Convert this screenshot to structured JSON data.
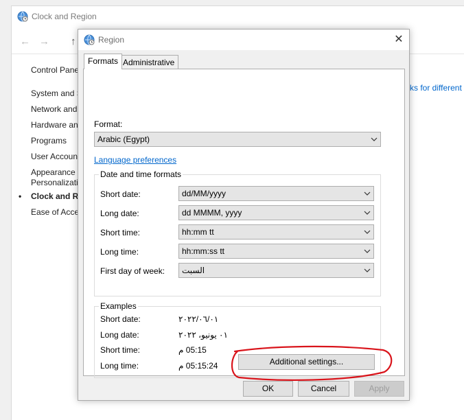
{
  "background_window": {
    "title": "Clock and Region",
    "sidebar": {
      "items": [
        {
          "label": "Control Pane"
        },
        {
          "label": "System and S"
        },
        {
          "label": "Network and"
        },
        {
          "label": "Hardware and"
        },
        {
          "label": "Programs"
        },
        {
          "label": "User Account"
        },
        {
          "label": "Appearance a"
        },
        {
          "label": "Personalizatio"
        },
        {
          "label": "Clock and Re"
        },
        {
          "label": "Ease of Acces"
        }
      ],
      "current_bullet": "•"
    },
    "link_fragment": "ks for different"
  },
  "dialog": {
    "title": "Region",
    "close_glyph": "✕",
    "tabs": [
      {
        "label": "Formats",
        "selected": true
      },
      {
        "label": "Administrative",
        "selected": false
      }
    ],
    "format": {
      "label": "Format:",
      "value": "Arabic (Egypt)"
    },
    "language_preferences_link": "Language preferences",
    "date_time_formats": {
      "title": "Date and time formats",
      "rows": [
        {
          "label": "Short date:",
          "value": "dd/MM/yyyy"
        },
        {
          "label": "Long date:",
          "value": "dd MMMM, yyyy"
        },
        {
          "label": "Short time:",
          "value": "hh:mm tt"
        },
        {
          "label": "Long time:",
          "value": "hh:mm:ss tt"
        },
        {
          "label": "First day of week:",
          "value": "السبت"
        }
      ]
    },
    "examples": {
      "title": "Examples",
      "rows": [
        {
          "label": "Short date:",
          "value": "٢٠٢٢/٠٦/٠١"
        },
        {
          "label": "Long date:",
          "value": "٠١ يونيو، ٢٠٢٢"
        },
        {
          "label": "Short time:",
          "value": "05:15 م"
        },
        {
          "label": "Long time:",
          "value": "05:15:24 م"
        }
      ]
    },
    "buttons": {
      "additional_settings": "Additional settings...",
      "ok": "OK",
      "cancel": "Cancel",
      "apply": "Apply"
    }
  },
  "colors": {
    "link": "#0066cc",
    "highlight_annotation": "#d9141b",
    "combo_background": "#e5e5e5"
  },
  "icons": {
    "title_icon": "globe-clock-icon",
    "dropdown": "chevron-down-icon",
    "back": "back-arrow-icon",
    "forward": "forward-arrow-icon",
    "up": "up-arrow-icon",
    "close": "close-icon"
  }
}
